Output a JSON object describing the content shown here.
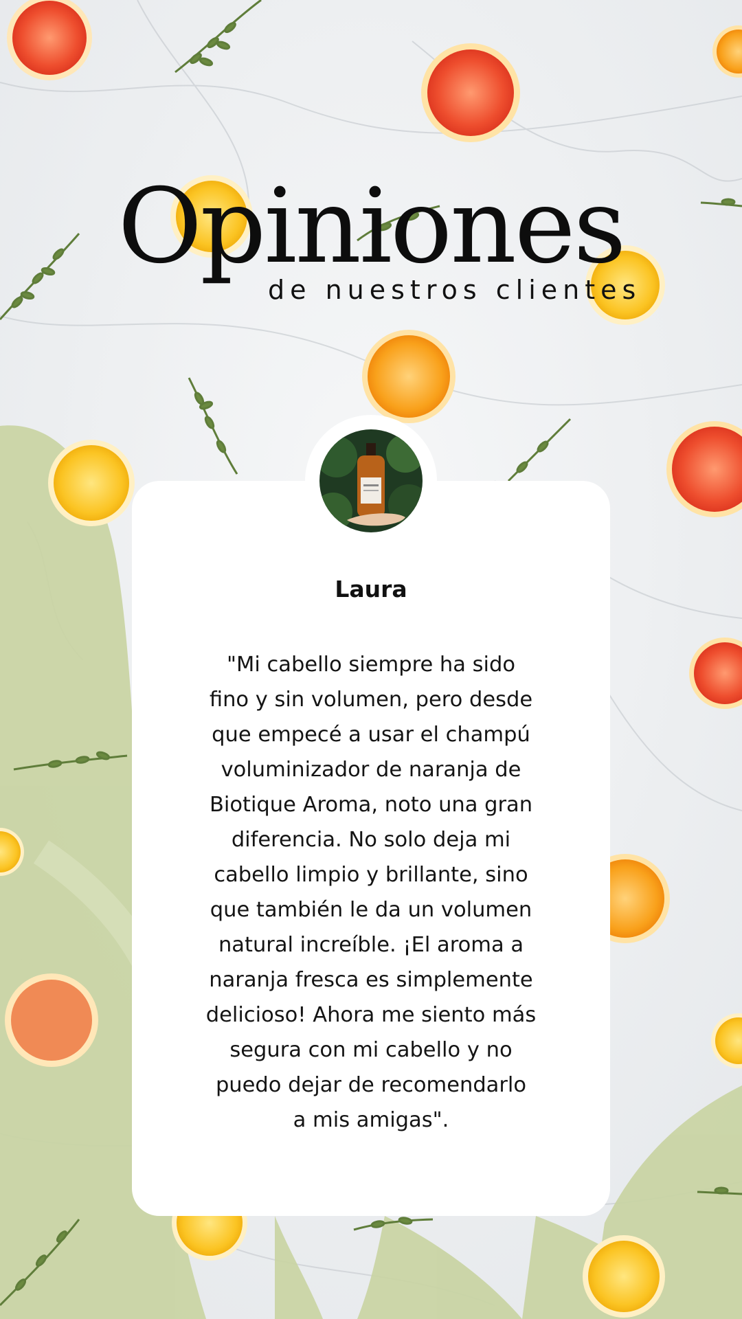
{
  "header": {
    "title": "Opiniones",
    "subtitle": "de nuestros clientes"
  },
  "testimonial": {
    "name": "Laura",
    "quote": "\"Mi cabello siempre ha sido\nfino y sin volumen, pero desde\nque empecé a usar el champú\nvoluminizador de naranja de\nBiotique Aroma, noto una gran\ndiferencia. No solo deja mi\ncabello limpio y brillante, sino\nque también le da un volumen\nnatural increíble. ¡El aroma a\nnaranja fresca es simplemente\ndelicioso! Ahora me siento más\nsegura con mi cabello y no\npuedo dejar de recomendarlo\na mis amigas\".",
    "avatar_icon": "product-bottle-photo"
  },
  "colors": {
    "marble": "#eef0f1",
    "leaf_green": "#c9d4a3",
    "orange": "#f9a11b",
    "grapefruit": "#ee4e2e",
    "lemon": "#fbc423",
    "card": "#ffffff"
  }
}
